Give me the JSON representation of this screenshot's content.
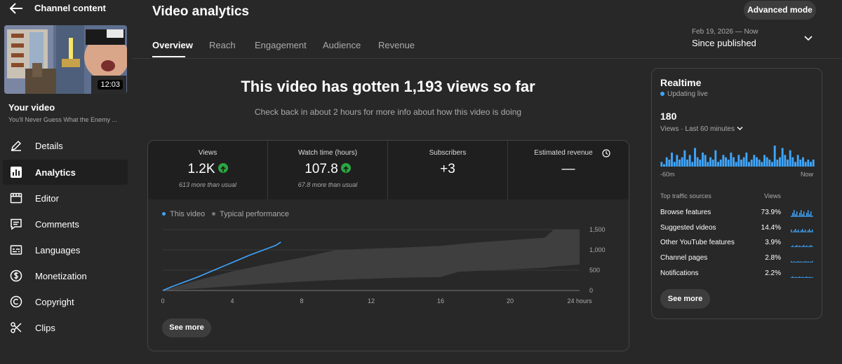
{
  "sidebar": {
    "title": "Channel content",
    "thumbnail_duration": "12:03",
    "your_video_label": "Your video",
    "video_title": "You'll Never Guess What the Enemy ...",
    "items": [
      {
        "label": "Details",
        "icon": "pencil-icon"
      },
      {
        "label": "Analytics",
        "icon": "analytics-icon",
        "active": true
      },
      {
        "label": "Editor",
        "icon": "editor-icon"
      },
      {
        "label": "Comments",
        "icon": "comments-icon"
      },
      {
        "label": "Languages",
        "icon": "subtitles-icon"
      },
      {
        "label": "Monetization",
        "icon": "dollar-icon"
      },
      {
        "label": "Copyright",
        "icon": "copyright-icon"
      },
      {
        "label": "Clips",
        "icon": "scissors-icon"
      }
    ]
  },
  "header": {
    "title": "Video analytics",
    "advanced_mode": "Advanced mode",
    "tabs": [
      "Overview",
      "Reach",
      "Engagement",
      "Audience",
      "Revenue"
    ],
    "date_range": "Feb 19, 2026 — Now",
    "date_label": "Since published"
  },
  "main": {
    "headline": "This video has gotten 1,193 views so far",
    "subline": "Check back in about 2 hours for more info about how this video is doing",
    "metrics": [
      {
        "label": "Views",
        "value": "1.2K",
        "sub": "613 more than usual",
        "trend": "up"
      },
      {
        "label": "Watch time (hours)",
        "value": "107.8",
        "sub": "67.8 more than usual",
        "trend": "up"
      },
      {
        "label": "Subscribers",
        "value": "+3",
        "sub": ""
      },
      {
        "label": "Estimated revenue",
        "value": "—",
        "sub": ""
      }
    ],
    "legend": [
      "This video",
      "Typical performance"
    ],
    "see_more": "See more"
  },
  "chart_data": {
    "type": "line",
    "x_ticks": [
      "0",
      "4",
      "8",
      "12",
      "16",
      "20",
      "24 hours"
    ],
    "y_ticks": [
      "0",
      "500",
      "1,000",
      "1,500"
    ],
    "xlim": [
      0,
      24
    ],
    "ylim": [
      0,
      1500
    ],
    "series": [
      {
        "name": "This video",
        "color": "#3ea6ff",
        "x": [
          0,
          0.5,
          1,
          1.5,
          2,
          2.5,
          3,
          3.5,
          4,
          4.5,
          5,
          5.5,
          6,
          6.5,
          6.8
        ],
        "y": [
          0,
          90,
          170,
          250,
          330,
          420,
          510,
          600,
          690,
          780,
          870,
          950,
          1030,
          1110,
          1193
        ]
      }
    ],
    "band": {
      "name": "Typical performance",
      "color": "#3f3f3f",
      "x": [
        0,
        2,
        4,
        6,
        8,
        10,
        12,
        14,
        16,
        17,
        18,
        20,
        22,
        22.5,
        24
      ],
      "low": [
        0,
        50,
        110,
        170,
        220,
        260,
        290,
        320,
        330,
        460,
        480,
        520,
        560,
        590,
        640
      ],
      "high": [
        0,
        250,
        470,
        650,
        810,
        1000,
        1030,
        1060,
        1100,
        1140,
        1180,
        1240,
        1300,
        1500,
        1500
      ]
    }
  },
  "realtime": {
    "title": "Realtime",
    "live": "Updating live",
    "count": "180",
    "sub": "Views · Last 60 minutes",
    "axis_start": "-60m",
    "axis_end": "Now",
    "bars": [
      2,
      1,
      4,
      3,
      6,
      2,
      5,
      3,
      4,
      7,
      3,
      5,
      2,
      8,
      4,
      3,
      6,
      5,
      2,
      4,
      3,
      7,
      2,
      3,
      5,
      4,
      3,
      6,
      4,
      2,
      5,
      3,
      4,
      6,
      2,
      3,
      5,
      4,
      3,
      2,
      5,
      4,
      3,
      2,
      9,
      3,
      4,
      8,
      5,
      3,
      7,
      4,
      2,
      5,
      3,
      4,
      2,
      3,
      2,
      3
    ],
    "bar_color": "#3ea6ff",
    "sources_header": "Top traffic sources",
    "sources_views_header": "Views",
    "sources": [
      {
        "name": "Browse features",
        "pct": "73.9%"
      },
      {
        "name": "Suggested videos",
        "pct": "14.4%"
      },
      {
        "name": "Other YouTube features",
        "pct": "3.9%"
      },
      {
        "name": "Channel pages",
        "pct": "2.8%"
      },
      {
        "name": "Notifications",
        "pct": "2.2%"
      }
    ],
    "see_more": "See more"
  }
}
